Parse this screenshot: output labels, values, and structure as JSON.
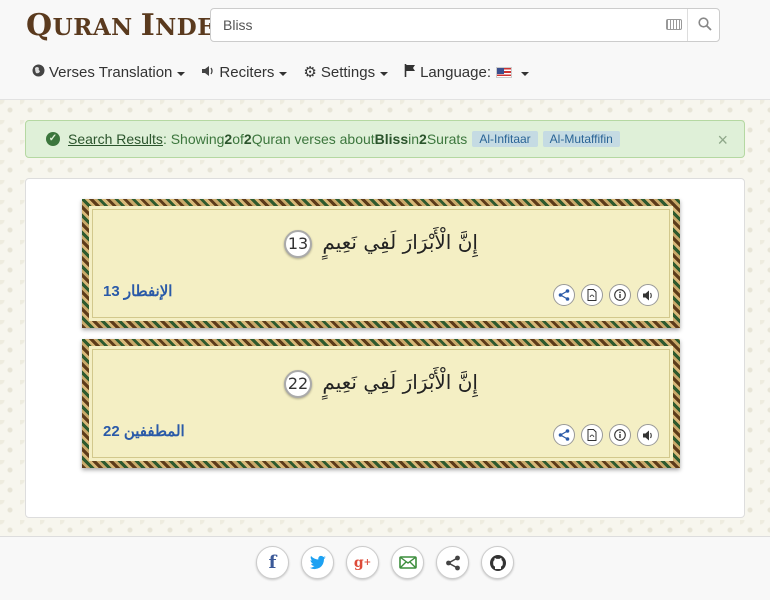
{
  "header": {
    "logo_main": "Q",
    "logo_rest": "URAN",
    "logo_main2": "I",
    "logo_rest2": "NDEX",
    "search_value": "Bliss"
  },
  "nav": {
    "items": [
      {
        "label": "Verses Translation",
        "icon": "globe-icon"
      },
      {
        "label": "Reciters",
        "icon": "volume-icon"
      },
      {
        "label": "Settings",
        "icon": "gear-icon"
      },
      {
        "label": "Language:",
        "icon": "flag-icon"
      }
    ]
  },
  "alert": {
    "link": "Search Results",
    "t1": ": Showing ",
    "shown": "2",
    "t2": " of ",
    "total": "2",
    "t3": " Quran verses about ",
    "term": "Bliss",
    "t4": " in ",
    "surats": "2",
    "t5": " Surats",
    "tags": [
      "Al-Infitaar",
      "Al-Mutaffifin"
    ],
    "close": "×"
  },
  "verses": [
    {
      "text": "إِنَّ الْأَبْرَارَ لَفِي نَعِيمٍ",
      "number": "13",
      "ref": "الإنفطار 13"
    },
    {
      "text": "إِنَّ الْأَبْرَارَ لَفِي نَعِيمٍ",
      "number": "22",
      "ref": "المطففين 22"
    }
  ],
  "colors": {
    "accent": "#2a5aa8",
    "alert_bg": "#dff0d8",
    "verse_bg": "#f4efc4",
    "frame": "#8a5a2a"
  },
  "footer": {
    "social": [
      "facebook-icon",
      "twitter-icon",
      "google-plus-icon",
      "email-icon",
      "share-icon",
      "github-icon"
    ]
  }
}
